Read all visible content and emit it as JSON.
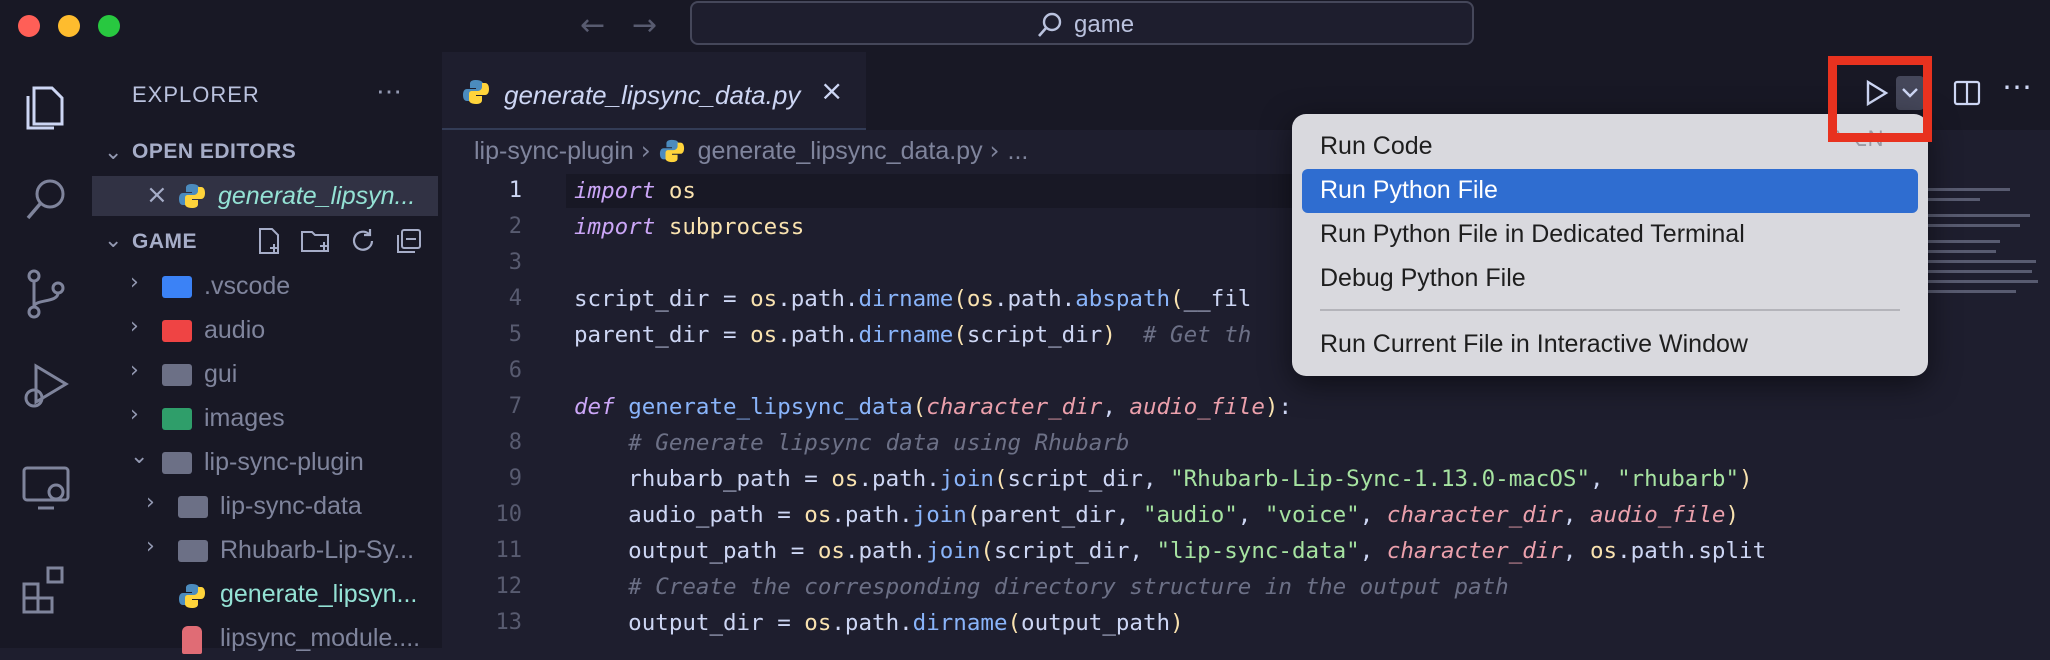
{
  "window": {
    "search_text": "game"
  },
  "explorer": {
    "title": "EXPLORER",
    "open_editors_label": "OPEN EDITORS",
    "open_editor_file": "generate_lipsyn...",
    "workspace_label": "GAME",
    "tree": [
      {
        "name": ".vscode",
        "kind": "folder",
        "color": "#3b82f6"
      },
      {
        "name": "audio",
        "kind": "folder",
        "color": "#ef4444"
      },
      {
        "name": "gui",
        "kind": "folder",
        "color": "#6c7086"
      },
      {
        "name": "images",
        "kind": "folder",
        "color": "#2f9e6a"
      },
      {
        "name": "lip-sync-plugin",
        "kind": "folder-open",
        "color": "#6c7086"
      },
      {
        "name": "lip-sync-data",
        "kind": "folder",
        "color": "#6c7086"
      },
      {
        "name": "Rhubarb-Lip-Sy...",
        "kind": "folder",
        "color": "#6c7086"
      },
      {
        "name": "generate_lipsyn...",
        "kind": "python"
      },
      {
        "name": "lipsync_module....",
        "kind": "file"
      }
    ]
  },
  "tab": {
    "label": "generate_lipsync_data.py"
  },
  "breadcrumb": {
    "folder": "lip-sync-plugin",
    "file": "generate_lipsync_data.py",
    "more": "..."
  },
  "line_numbers": [
    "1",
    "2",
    "3",
    "4",
    "5",
    "6",
    "7",
    "8",
    "9",
    "10",
    "11",
    "12",
    "13"
  ],
  "code_lines": [
    "import os",
    "import subprocess",
    "",
    "script_dir = os.path.dirname(os.path.abspath(__fil",
    "parent_dir = os.path.dirname(script_dir)  # Get th",
    "",
    "def generate_lipsync_data(character_dir, audio_file):",
    "    # Generate lipsync data using Rhubarb",
    "    rhubarb_path = os.path.join(script_dir, \"Rhubarb-Lip-Sync-1.13.0-macOS\", \"rhubarb\")",
    "    audio_path = os.path.join(parent_dir, \"audio\", \"voice\", character_dir, audio_file)",
    "    output_path = os.path.join(script_dir, \"lip-sync-data\", character_dir, os.path.split",
    "    # Create the corresponding directory structure in the output path",
    "    output_dir = os.path.dirname(output_path)"
  ],
  "run_menu": {
    "items": [
      "Run Code",
      "Run Python File",
      "Run Python File in Dedicated Terminal",
      "Debug Python File",
      "Run Current File in Interactive Window"
    ],
    "selected": "Run Python File",
    "shortcut": "^⌥N"
  },
  "colors": {
    "highlight": "#e8321f",
    "selection": "#2f6dd0"
  }
}
